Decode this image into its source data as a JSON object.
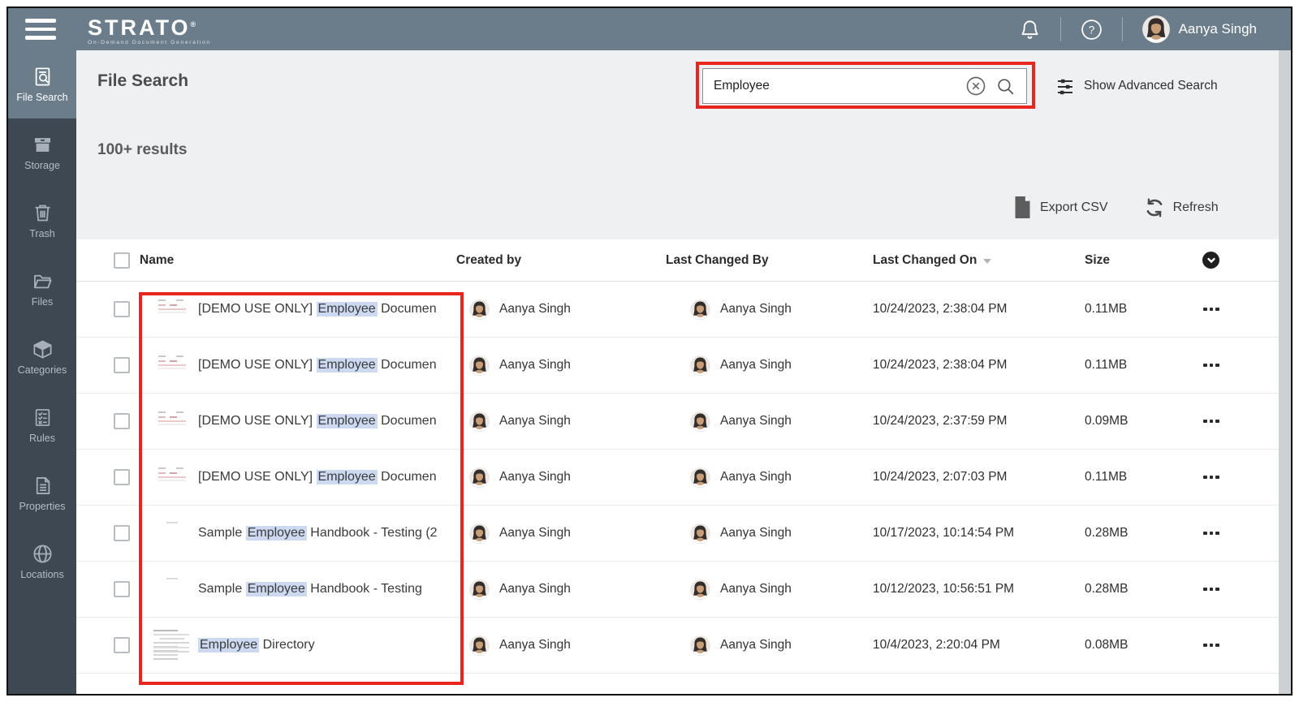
{
  "colors": {
    "topbar_bg": "#6b7c8b",
    "sidebar_bg": "#3d4853",
    "sidebar_active_bg": "#6b7c8b",
    "main_bg": "#eef0f2",
    "annotation_red": "#e8251f",
    "search_highlight_bg": "#ccd9f1"
  },
  "topbar": {
    "logo": "STRATO",
    "logo_mark": "®",
    "tagline": "On-Demand Document Generation",
    "user_name": "Aanya Singh"
  },
  "sidebar": {
    "items": [
      {
        "label": "File Search",
        "icon": "file-search-icon",
        "active": true
      },
      {
        "label": "Storage",
        "icon": "storage-icon",
        "active": false
      },
      {
        "label": "Trash",
        "icon": "trash-icon",
        "active": false
      },
      {
        "label": "Files",
        "icon": "files-icon",
        "active": false
      },
      {
        "label": "Categories",
        "icon": "categories-icon",
        "active": false
      },
      {
        "label": "Rules",
        "icon": "rules-icon",
        "active": false
      },
      {
        "label": "Properties",
        "icon": "properties-icon",
        "active": false
      },
      {
        "label": "Locations",
        "icon": "locations-icon",
        "active": false
      }
    ]
  },
  "page": {
    "title": "File Search",
    "results_count": "100+ results",
    "advanced_search_label": "Show Advanced Search"
  },
  "search": {
    "value": "Employee"
  },
  "toolbar": {
    "export_label": "Export CSV",
    "refresh_label": "Refresh"
  },
  "table": {
    "headers": {
      "name": "Name",
      "created_by": "Created by",
      "last_changed_by": "Last Changed By",
      "last_changed_on": "Last Changed On",
      "size": "Size"
    },
    "rows": [
      {
        "name_pre": "[DEMO USE ONLY] ",
        "name_hl": "Employee",
        "name_post": " Documen",
        "created_by": "Aanya Singh",
        "last_changed_by": "Aanya Singh",
        "last_changed_on": "10/24/2023, 2:38:04 PM",
        "size": "0.11MB",
        "thumb": "thumb-faint"
      },
      {
        "name_pre": "[DEMO USE ONLY] ",
        "name_hl": "Employee",
        "name_post": " Documen",
        "created_by": "Aanya Singh",
        "last_changed_by": "Aanya Singh",
        "last_changed_on": "10/24/2023, 2:38:04 PM",
        "size": "0.11MB",
        "thumb": "thumb-faint"
      },
      {
        "name_pre": "[DEMO USE ONLY] ",
        "name_hl": "Employee",
        "name_post": " Documen",
        "created_by": "Aanya Singh",
        "last_changed_by": "Aanya Singh",
        "last_changed_on": "10/24/2023, 2:37:59 PM",
        "size": "0.09MB",
        "thumb": "thumb-faint"
      },
      {
        "name_pre": "[DEMO USE ONLY] ",
        "name_hl": "Employee",
        "name_post": " Documen",
        "created_by": "Aanya Singh",
        "last_changed_by": "Aanya Singh",
        "last_changed_on": "10/24/2023, 2:07:03 PM",
        "size": "0.11MB",
        "thumb": "thumb-faint"
      },
      {
        "name_pre": "Sample ",
        "name_hl": "Employee",
        "name_post": " Handbook - Testing (2",
        "created_by": "Aanya Singh",
        "last_changed_by": "Aanya Singh",
        "last_changed_on": "10/17/2023, 10:14:54 PM",
        "size": "0.28MB",
        "thumb": "thumb-blank"
      },
      {
        "name_pre": "Sample ",
        "name_hl": "Employee",
        "name_post": " Handbook - Testing",
        "created_by": "Aanya Singh",
        "last_changed_by": "Aanya Singh",
        "last_changed_on": "10/12/2023, 10:56:51 PM",
        "size": "0.28MB",
        "thumb": "thumb-blank"
      },
      {
        "name_pre": "",
        "name_hl": "Employee",
        "name_post": " Directory",
        "created_by": "Aanya Singh",
        "last_changed_by": "Aanya Singh",
        "last_changed_on": "10/4/2023, 2:20:04 PM",
        "size": "0.08MB",
        "thumb": "thumb-text"
      }
    ]
  }
}
